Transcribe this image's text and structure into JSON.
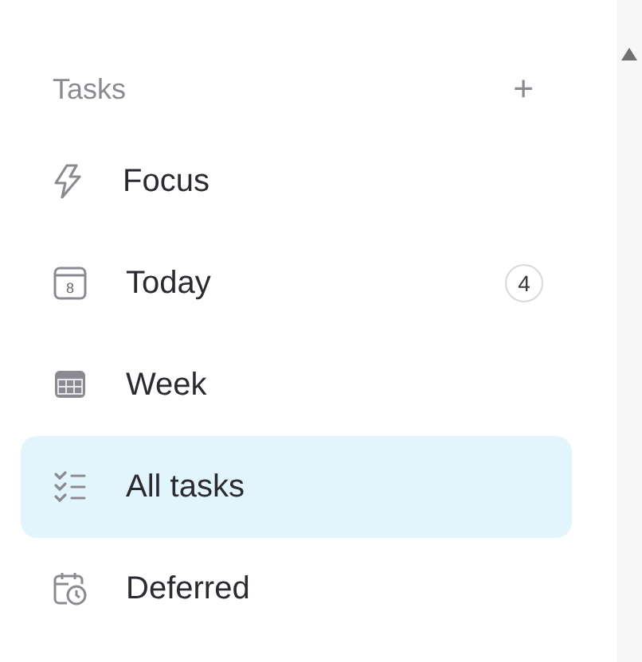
{
  "section": {
    "title": "Tasks",
    "add_button": "+"
  },
  "items": [
    {
      "label": "Focus",
      "selected": false
    },
    {
      "label": "Today",
      "selected": false,
      "icon_text": "8",
      "count": "4"
    },
    {
      "label": "Week",
      "selected": false
    },
    {
      "label": "All tasks",
      "selected": true
    },
    {
      "label": "Deferred",
      "selected": false
    }
  ]
}
